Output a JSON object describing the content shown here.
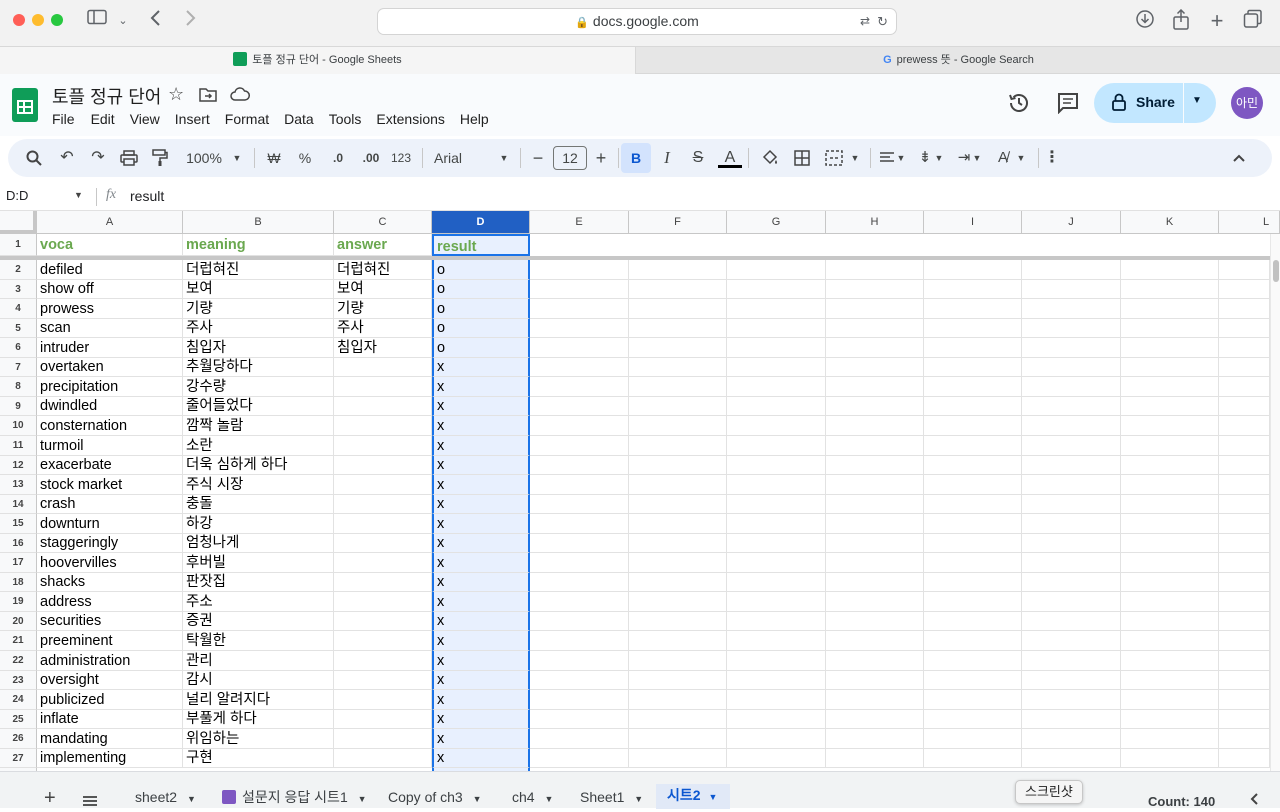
{
  "browser": {
    "url": "docs.google.com",
    "tabs": [
      {
        "label": "토플 정규 단어 - Google Sheets",
        "active": true
      },
      {
        "label": "prewess 뜻 - Google Search",
        "active": false
      }
    ]
  },
  "doc": {
    "title": "토플 정규 단어",
    "menu": [
      "File",
      "Edit",
      "View",
      "Insert",
      "Format",
      "Data",
      "Tools",
      "Extensions",
      "Help"
    ],
    "share_label": "Share",
    "avatar": "아민"
  },
  "toolbar": {
    "zoom": "100%",
    "currency": "₩",
    "percent": "%",
    "dec_dec": ".0",
    "dec_inc": ".00",
    "format_123": "123",
    "font": "Arial",
    "font_size": "12"
  },
  "formula": {
    "name_box": "D:D",
    "fx": "fx",
    "value": "result"
  },
  "grid": {
    "columns": [
      "A",
      "B",
      "C",
      "D",
      "E",
      "F",
      "G",
      "H",
      "I",
      "J",
      "K",
      "L"
    ],
    "header_row": {
      "num": "1",
      "a": "voca",
      "b": "meaning",
      "c": "answer",
      "d": "result"
    },
    "rows": [
      {
        "num": "2",
        "a": "defiled",
        "b": "더럽혀진",
        "c": "더럽혀진",
        "d": "o"
      },
      {
        "num": "3",
        "a": "show off",
        "b": "보여",
        "c": "보여",
        "d": "o"
      },
      {
        "num": "4",
        "a": "prowess",
        "b": "기량",
        "c": "기량",
        "d": "o"
      },
      {
        "num": "5",
        "a": "scan",
        "b": "주사",
        "c": "주사",
        "d": "o"
      },
      {
        "num": "6",
        "a": "intruder",
        "b": "침입자",
        "c": "침입자",
        "d": "o"
      },
      {
        "num": "7",
        "a": "overtaken",
        "b": "추월당하다",
        "c": "",
        "d": "x"
      },
      {
        "num": "8",
        "a": "precipitation",
        "b": "강수량",
        "c": "",
        "d": "x"
      },
      {
        "num": "9",
        "a": "dwindled",
        "b": "줄어들었다",
        "c": "",
        "d": "x"
      },
      {
        "num": "10",
        "a": "consternation",
        "b": "깜짝 놀람",
        "c": "",
        "d": "x"
      },
      {
        "num": "11",
        "a": "turmoil",
        "b": "소란",
        "c": "",
        "d": "x"
      },
      {
        "num": "12",
        "a": "exacerbate",
        "b": "더욱 심하게 하다",
        "c": "",
        "d": "x"
      },
      {
        "num": "13",
        "a": "stock market",
        "b": "주식 시장",
        "c": "",
        "d": "x"
      },
      {
        "num": "14",
        "a": "crash",
        "b": "충돌",
        "c": "",
        "d": "x"
      },
      {
        "num": "15",
        "a": "downturn",
        "b": "하강",
        "c": "",
        "d": "x"
      },
      {
        "num": "16",
        "a": "staggeringly",
        "b": "엄청나게",
        "c": "",
        "d": "x"
      },
      {
        "num": "17",
        "a": "hoovervilles",
        "b": "후버빌",
        "c": "",
        "d": "x"
      },
      {
        "num": "18",
        "a": "shacks",
        "b": "판잣집",
        "c": "",
        "d": "x"
      },
      {
        "num": "19",
        "a": "address",
        "b": "주소",
        "c": "",
        "d": "x"
      },
      {
        "num": "20",
        "a": "securities",
        "b": "증권",
        "c": "",
        "d": "x"
      },
      {
        "num": "21",
        "a": "preeminent",
        "b": "탁월한",
        "c": "",
        "d": "x"
      },
      {
        "num": "22",
        "a": "administration",
        "b": "관리",
        "c": "",
        "d": "x"
      },
      {
        "num": "23",
        "a": "oversight",
        "b": "감시",
        "c": "",
        "d": "x"
      },
      {
        "num": "24",
        "a": "publicized",
        "b": "널리 알려지다",
        "c": "",
        "d": "x"
      },
      {
        "num": "25",
        "a": "inflate",
        "b": "부풀게 하다",
        "c": "",
        "d": "x"
      },
      {
        "num": "26",
        "a": "mandating",
        "b": "위임하는",
        "c": "",
        "d": "x"
      },
      {
        "num": "27",
        "a": "implementing",
        "b": "구현",
        "c": "",
        "d": "x"
      }
    ]
  },
  "sheet_tabs": [
    "sheet2",
    "설문지 응답 시트1",
    "Copy of ch3",
    "ch4",
    "Sheet1",
    "시트2"
  ],
  "active_sheet": "시트2",
  "tooltip": "스크린샷",
  "status": "Count: 140",
  "colors": {
    "header_text": "#6aa84f",
    "selection": "#1a73e8",
    "share_bg": "#c2e7ff"
  }
}
